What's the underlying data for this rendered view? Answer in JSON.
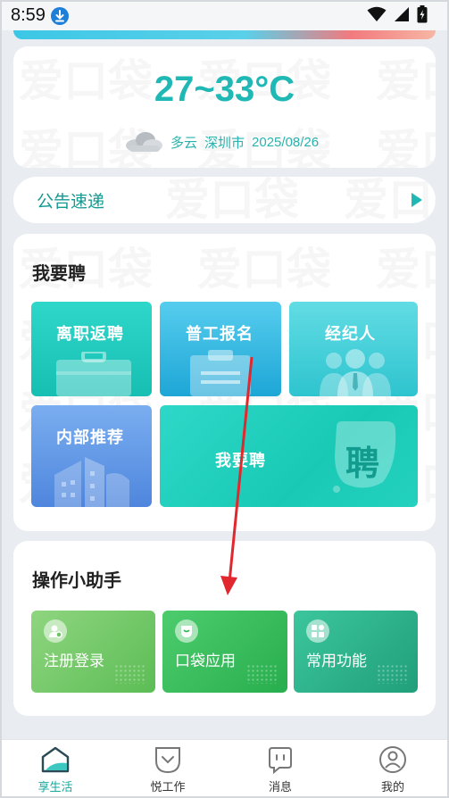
{
  "status_bar": {
    "time": "8:59"
  },
  "weather": {
    "temperature": "27~33°C",
    "condition": "多云",
    "city": "深圳市",
    "date": "2025/08/26"
  },
  "watermark_text": "爱口袋",
  "notice": {
    "title": "公告速递"
  },
  "hire": {
    "title": "我要聘",
    "tiles": [
      {
        "label": "离职返聘"
      },
      {
        "label": "普工报名"
      },
      {
        "label": "经纪人"
      },
      {
        "label": "内部推荐"
      },
      {
        "label": "我要聘",
        "badge": "聘"
      }
    ]
  },
  "helper": {
    "title": "操作小助手",
    "tiles": [
      {
        "label": "注册登录"
      },
      {
        "label": "口袋应用"
      },
      {
        "label": "常用功能"
      }
    ]
  },
  "bottom_nav": {
    "items": [
      {
        "label": "享生活",
        "active": true
      },
      {
        "label": "悦工作"
      },
      {
        "label": "消息"
      },
      {
        "label": "我的"
      }
    ]
  },
  "colors": {
    "accent": "#1fb8b5",
    "annotation_arrow": "#e0282e"
  }
}
